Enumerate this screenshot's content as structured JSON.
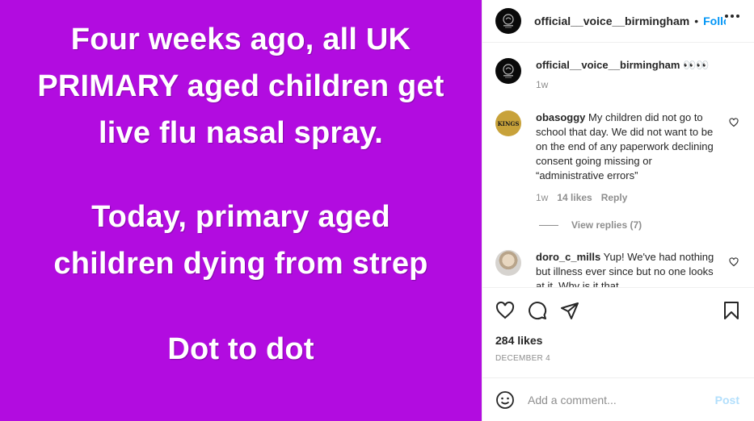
{
  "post_image": {
    "paragraphs": [
      [
        "Four weeks ago, all UK",
        "PRIMARY aged children get",
        "live flu nasal spray."
      ],
      [
        "Today, primary aged",
        "children dying from strep"
      ],
      [
        "Dot to dot"
      ]
    ],
    "background_color": "#b20ce0"
  },
  "header": {
    "username": "official__voice__birmingham",
    "dot": "•",
    "follow_label": "Follow",
    "more_icon": "more-horizontal-icon"
  },
  "caption": {
    "username": "official__voice__birmingham",
    "text": "👀👀",
    "time": "1w"
  },
  "comments": [
    {
      "username": "obasoggy",
      "avatar_text": "KINGS",
      "text": "My children did not go to school that day. We did not want to be on the end of any paperwork declining consent going missing or “administrative errors”",
      "time": "1w",
      "likes": "14 likes",
      "reply_label": "Reply"
    },
    {
      "username": "doro_c_mills",
      "text": "Yup! We've had nothing but illness ever since but no one looks at it. Why is it that"
    }
  ],
  "view_replies": "View replies (7)",
  "actions": {
    "icons": [
      "heart-icon",
      "comment-icon",
      "share-icon",
      "bookmark-icon"
    ],
    "likes": "284 likes",
    "date": "DECEMBER 4"
  },
  "add_comment": {
    "placeholder": "Add a comment...",
    "post_label": "Post"
  },
  "colors": {
    "accent": "#0095f6",
    "post_disabled": "#b2dffc",
    "muted": "#8e8e8e"
  }
}
